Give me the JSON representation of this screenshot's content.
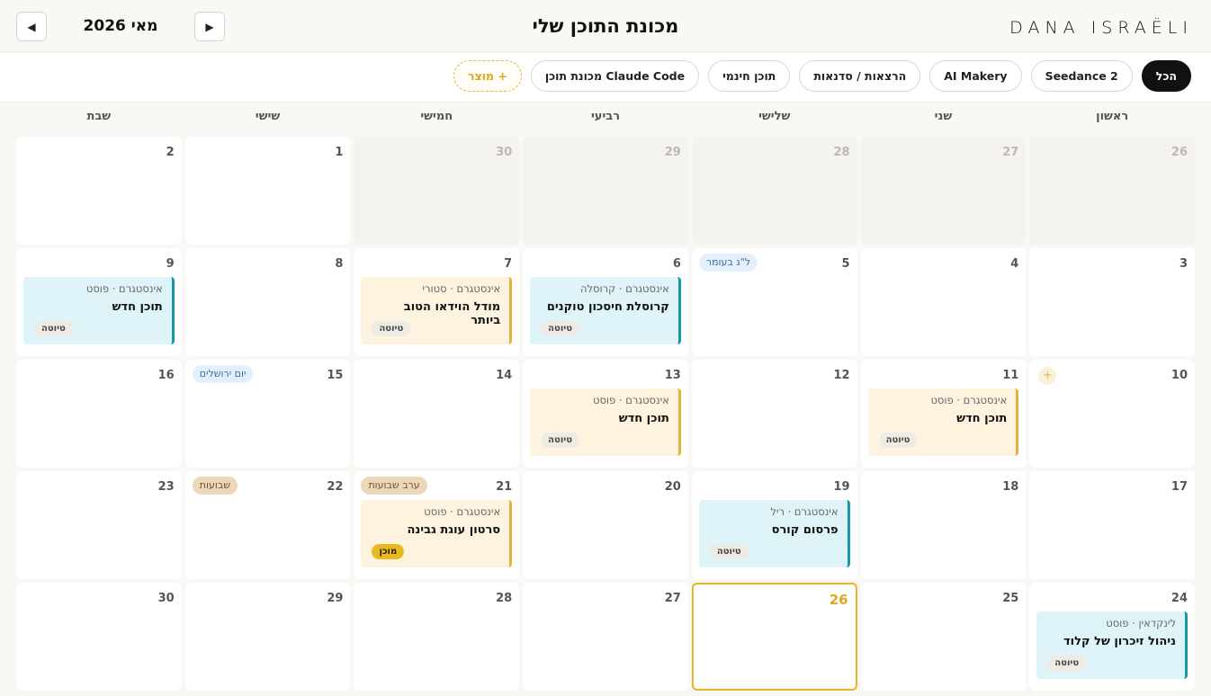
{
  "brand": "DANA ISRAËLI",
  "page_title": "מכונת התוכן שלי",
  "month_label": "מאי 2026",
  "nav": {
    "prev_glyph": "◀",
    "next_glyph": "▶"
  },
  "filters": [
    {
      "label": "הכל",
      "active": true
    },
    {
      "label": "Seedance 2"
    },
    {
      "label": "AI Makery"
    },
    {
      "label": "הרצאות / סדנאות"
    },
    {
      "label": "תוכן חינמי"
    },
    {
      "label": "Claude Code מכונת תוכן"
    },
    {
      "label": "+ מוצר",
      "add": true
    }
  ],
  "weekdays": [
    "ראשון",
    "שני",
    "שלישי",
    "רביעי",
    "חמישי",
    "שישי",
    "שבת"
  ],
  "add_glyph": "+",
  "days": [
    {
      "num": "26",
      "out": true
    },
    {
      "num": "27",
      "out": true
    },
    {
      "num": "28",
      "out": true
    },
    {
      "num": "29",
      "out": true
    },
    {
      "num": "30",
      "out": true
    },
    {
      "num": "1"
    },
    {
      "num": "2"
    },
    {
      "num": "3"
    },
    {
      "num": "4"
    },
    {
      "num": "5",
      "holiday": {
        "label": "ל\"ג בעומר",
        "style": "blue"
      }
    },
    {
      "num": "6",
      "card": {
        "meta": "אינסטגרם · קרוסלה",
        "title": "קרוסלת חיסכון טוקנים",
        "status": "טיוטה",
        "color": "teal"
      }
    },
    {
      "num": "7",
      "card": {
        "meta": "אינסטגרם · סטורי",
        "title": "מודל הוידאו הטוב ביותר",
        "status": "טיוטה",
        "color": "amber"
      }
    },
    {
      "num": "8"
    },
    {
      "num": "9",
      "card": {
        "meta": "אינסטגרם · פוסט",
        "title": "תוכן חדש",
        "status": "טיוטה",
        "color": "teal"
      }
    },
    {
      "num": "10",
      "plus": true
    },
    {
      "num": "11",
      "card": {
        "meta": "אינסטגרם · פוסט",
        "title": "תוכן חדש",
        "status": "טיוטה",
        "color": "amber"
      }
    },
    {
      "num": "12"
    },
    {
      "num": "13",
      "card": {
        "meta": "אינסטגרם · פוסט",
        "title": "תוכן חדש",
        "status": "טיוטה",
        "color": "amber"
      }
    },
    {
      "num": "14"
    },
    {
      "num": "15",
      "holiday": {
        "label": "יום ירושלים",
        "style": "blue"
      }
    },
    {
      "num": "16"
    },
    {
      "num": "17"
    },
    {
      "num": "18"
    },
    {
      "num": "19",
      "card": {
        "meta": "אינסטגרם · ריל",
        "title": "פרסום קורס",
        "status": "טיוטה",
        "color": "teal"
      }
    },
    {
      "num": "20"
    },
    {
      "num": "21",
      "holiday": {
        "label": "ערב שבועות",
        "style": "tan"
      },
      "card": {
        "meta": "אינסטגרם · פוסט",
        "title": "סרטון עוגת גבינה",
        "status": "מוכן",
        "color": "amber",
        "ready": true
      }
    },
    {
      "num": "22",
      "holiday": {
        "label": "שבועות",
        "style": "tan"
      }
    },
    {
      "num": "23"
    },
    {
      "num": "24",
      "card": {
        "meta": "לינקדאין · פוסט",
        "title": "ניהול זיכרון של קלוד",
        "status": "טיוטה",
        "color": "teal"
      }
    },
    {
      "num": "25"
    },
    {
      "num": "26",
      "today": true
    },
    {
      "num": "27"
    },
    {
      "num": "28"
    },
    {
      "num": "29"
    },
    {
      "num": "30"
    }
  ]
}
